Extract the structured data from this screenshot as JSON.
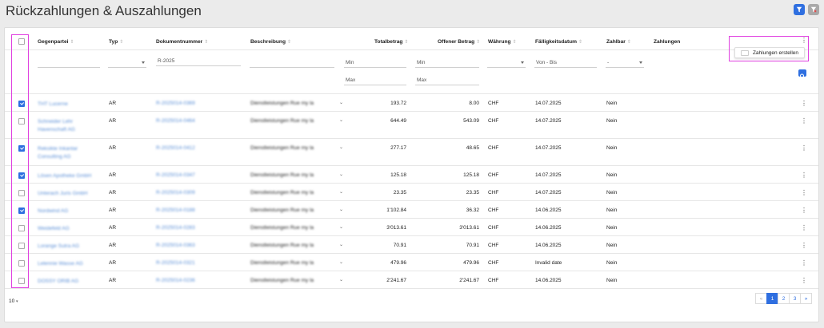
{
  "page": {
    "title": "Rückzahlungen & Auszahlungen"
  },
  "colors": {
    "accent": "#2f6fe0",
    "highlight": "#e040e0"
  },
  "toolbar": {
    "filter_icon": "filter-icon",
    "clear_filter_icon": "filter-clear-icon"
  },
  "table": {
    "headers": {
      "gegenpartei": "Gegenpartei",
      "typ": "Typ",
      "dokumentnummer": "Dokumentnummer",
      "beschreibung": "Beschreibung",
      "totalbetrag": "Totalbetrag",
      "offener_betrag": "Offener Betrag",
      "waehrung": "Währung",
      "faelligkeitsdatum": "Fälligkeitsdatum",
      "zahlbar": "Zahlbar",
      "zahlungen": "Zahlungen"
    },
    "filters": {
      "dokumentnummer_value": "R-2025",
      "total_min": "Min",
      "total_max": "Max",
      "offen_min": "Min",
      "offen_max": "Max",
      "date_placeholder": "Von - Bis",
      "zahlbar_value": "-"
    },
    "row_menu": {
      "zahlungen_erstellen": "Zahlungen erstellen"
    },
    "rows": [
      {
        "checked": true,
        "gegenpartei": "THT Lucerne",
        "typ": "AR",
        "dok": "R-2025014-0369",
        "beschreibung": "Dienstleistungen Rue my la",
        "total": "193.72",
        "offen": "8.00",
        "waehrung": "CHF",
        "datum": "14.07.2025",
        "zahlbar": "Nein"
      },
      {
        "checked": false,
        "gegenpartei": "Schneider Lehr Havenschaft AG",
        "typ": "AR",
        "dok": "R-2025014-0464",
        "beschreibung": "Dienstleistungen Rue my la",
        "total": "644.49",
        "offen": "543.09",
        "waehrung": "CHF",
        "datum": "14.07.2025",
        "zahlbar": "Nein"
      },
      {
        "checked": true,
        "gegenpartei": "Reksikte Inkantar Consulting AG",
        "typ": "AR",
        "dok": "R-2025014-0412",
        "beschreibung": "Dienstleistungen Rue my la",
        "total": "277.17",
        "offen": "48.65",
        "waehrung": "CHF",
        "datum": "14.07.2025",
        "zahlbar": "Nein"
      },
      {
        "checked": true,
        "gegenpartei": "Lösen Apotheke GmbH",
        "typ": "AR",
        "dok": "R-2025014-0347",
        "beschreibung": "Dienstleistungen Rue my la",
        "total": "125.18",
        "offen": "125.18",
        "waehrung": "CHF",
        "datum": "14.07.2025",
        "zahlbar": "Nein"
      },
      {
        "checked": false,
        "gegenpartei": "Unterach Juris GmbH",
        "typ": "AR",
        "dok": "R-2025014-0309",
        "beschreibung": "Dienstleistungen Rue my la",
        "total": "23.35",
        "offen": "23.35",
        "waehrung": "CHF",
        "datum": "14.07.2025",
        "zahlbar": "Nein"
      },
      {
        "checked": true,
        "gegenpartei": "Nordwind AG",
        "typ": "AR",
        "dok": "R-2025014-0188",
        "beschreibung": "Dienstleistungen Rue my la",
        "total": "1'102.84",
        "offen": "36.32",
        "waehrung": "CHF",
        "datum": "14.06.2025",
        "zahlbar": "Nein"
      },
      {
        "checked": false,
        "gegenpartei": "Weidefeld AG",
        "typ": "AR",
        "dok": "R-2025014-0283",
        "beschreibung": "Dienstleistungen Rue my la",
        "total": "3'013.61",
        "offen": "3'013.61",
        "waehrung": "CHF",
        "datum": "14.06.2025",
        "zahlbar": "Nein"
      },
      {
        "checked": false,
        "gegenpartei": "Lorange Sutra AG",
        "typ": "AR",
        "dok": "R-2025014-0363",
        "beschreibung": "Dienstleistungen Rue my la",
        "total": "70.91",
        "offen": "70.91",
        "waehrung": "CHF",
        "datum": "14.06.2025",
        "zahlbar": "Nein"
      },
      {
        "checked": false,
        "gegenpartei": "Lelennie Wasse AG",
        "typ": "AR",
        "dok": "R-2025014-0321",
        "beschreibung": "Dienstleistungen Rue my la",
        "total": "479.96",
        "offen": "479.96",
        "waehrung": "CHF",
        "datum": "Invalid date",
        "zahlbar": "Nein"
      },
      {
        "checked": false,
        "gegenpartei": "DOSSY ORIB AG",
        "typ": "AR",
        "dok": "R-2025014-0236",
        "beschreibung": "Dienstleistungen Rue my la",
        "total": "2'241.67",
        "offen": "2'241.67",
        "waehrung": "CHF",
        "datum": "14.06.2025",
        "zahlbar": "Nein"
      }
    ]
  },
  "pagination": {
    "prev": "«",
    "pages": [
      "1",
      "2",
      "3"
    ],
    "next": "»",
    "current": "1"
  },
  "page_size": {
    "value": "10"
  }
}
